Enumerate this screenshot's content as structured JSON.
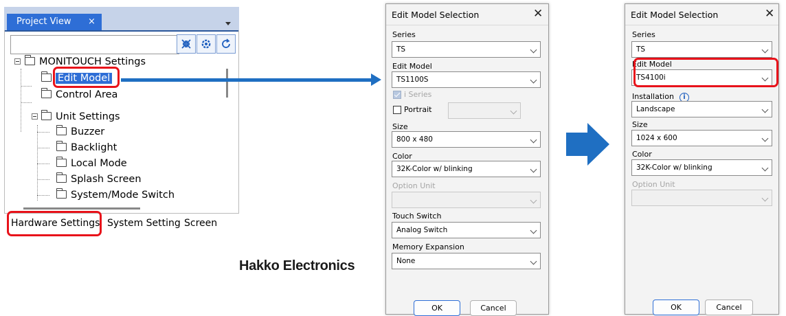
{
  "project_view": {
    "tab_label": "Project View",
    "tab_close": "×",
    "search_value": "",
    "toolbar_icons": [
      "collapse-all-icon",
      "settings-icon",
      "refresh-icon"
    ],
    "tree": {
      "root": "MONITOUCH Settings",
      "items": [
        "Edit Model",
        "Control Area",
        "Unit Settings",
        "Buzzer",
        "Backlight",
        "Local Mode",
        "Splash Screen",
        "System/Mode Switch"
      ]
    },
    "bottom_tabs": [
      "Hardware Settings",
      "System Settings",
      "Screen"
    ]
  },
  "company": "Hakko Electronics",
  "dialog1": {
    "title": "Edit Model Selection",
    "close": "✕",
    "series_label": "Series",
    "series_value": "TS",
    "edit_model_label": "Edit Model",
    "edit_model_value": "TS1100S",
    "i_series_label": "i Series",
    "portrait_label": "Portrait",
    "portrait_value": "",
    "size_label": "Size",
    "size_value": "800 x 480",
    "color_label": "Color",
    "color_value": "32K-Color w/  blinking",
    "option_unit_label": "Option Unit",
    "option_unit_value": "",
    "touch_switch_label": "Touch Switch",
    "touch_switch_value": "Analog Switch",
    "memory_expansion_label": "Memory Expansion",
    "memory_expansion_value": "None",
    "ok": "OK",
    "cancel": "Cancel"
  },
  "dialog2": {
    "title": "Edit Model Selection",
    "close": "✕",
    "series_label": "Series",
    "series_value": "TS",
    "edit_model_label": "Edit Model",
    "edit_model_value": "TS4100i",
    "installation_label": "Installation",
    "info_glyph": "i",
    "installation_value": "Landscape",
    "size_label": "Size",
    "size_value": "1024 x 600",
    "color_label": "Color",
    "color_value": "32K-Color w/  blinking",
    "option_unit_label": "Option Unit",
    "option_unit_value": "",
    "ok": "OK",
    "cancel": "Cancel"
  },
  "colors": {
    "accent": "#2e6ed6",
    "highlight": "#e8121a",
    "arrow": "#1f6fc2"
  }
}
